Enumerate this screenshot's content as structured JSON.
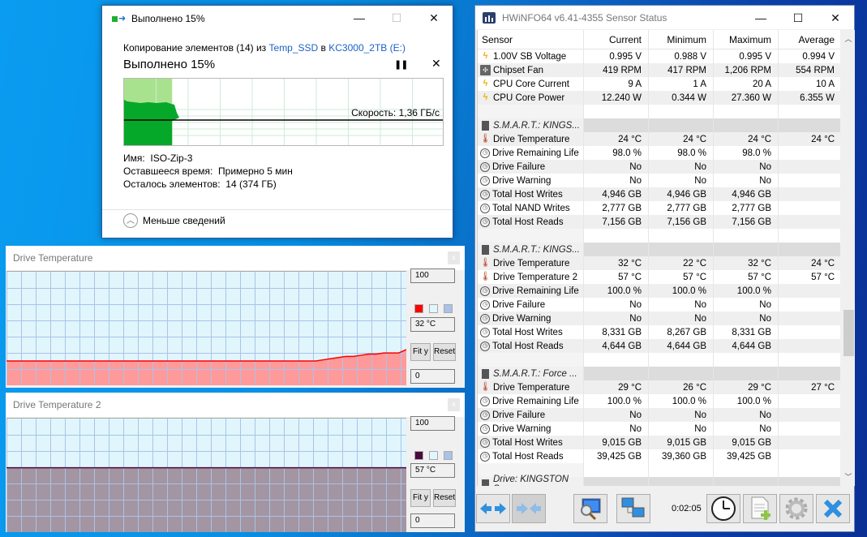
{
  "copy_dialog": {
    "title": "Выполнено 15%",
    "line_prefix": "Копирование элементов (14) из ",
    "source": "Temp_SSD",
    "line_mid": " в ",
    "dest": "KC3000_2TB (E:)",
    "progress_label": "Выполнено 15%",
    "progress_percent": 15,
    "pause_icon": "pause-icon",
    "cancel_icon": "close-icon",
    "speed": "Скорость: 1,36 ГБ/с",
    "name_label": "Имя:",
    "name_value": "ISO-Zip-3",
    "time_label": "Оставшееся время:",
    "time_value": "Примерно 5 мин",
    "items_label": "Осталось элементов:",
    "items_value": "14 (374 ГБ)",
    "less_details": "Меньше сведений",
    "caption": {
      "minimize": "—",
      "maximize": "☐",
      "close": "✕"
    }
  },
  "graph_windows": [
    {
      "title": "Drive Temperature",
      "max": "100",
      "current": "32 °C",
      "min": "0",
      "fit_label": "Fit y",
      "reset_label": "Reset",
      "close": "x",
      "line_color": "#ff0000",
      "fill_color": "#ff9a9a",
      "bg_color": "#e0f6fc",
      "grid_color": "#a9c3e8",
      "chart_data": {
        "type": "area",
        "ylim": [
          0,
          100
        ],
        "values_note": "flat ~22 then step up to ~32 at end",
        "values": [
          22,
          22,
          22,
          22,
          22,
          22,
          22,
          22,
          22,
          22,
          22,
          22,
          22,
          22,
          22,
          22,
          22,
          22,
          22,
          22,
          22,
          22,
          22,
          22,
          22,
          22,
          22,
          22,
          22,
          22,
          22,
          22,
          22,
          22,
          22,
          22,
          22,
          22,
          22,
          22,
          22,
          22,
          23,
          24,
          25,
          26,
          26,
          27,
          28,
          28,
          29,
          29,
          29,
          32
        ]
      }
    },
    {
      "title": "Drive Temperature 2",
      "max": "100",
      "current": "57 °C",
      "min": "0",
      "fit_label": "Fit y",
      "reset_label": "Reset",
      "close": "x",
      "line_color": "#4a0a3a",
      "fill_color": "#a395a2",
      "bg_color": "#e0f6fc",
      "grid_color": "#a9c3e8",
      "chart_data": {
        "type": "area",
        "ylim": [
          0,
          100
        ],
        "values": [
          57,
          57,
          57,
          57,
          57,
          57,
          57,
          57,
          57,
          57
        ]
      }
    }
  ],
  "hwinfo": {
    "title": "HWiNFO64 v6.41-4355 Sensor Status",
    "caption": {
      "minimize": "—",
      "maximize": "☐",
      "close": "✕"
    },
    "columns": [
      "Sensor",
      "Current",
      "Minimum",
      "Maximum",
      "Average"
    ],
    "rows": [
      {
        "type": "data",
        "icon": "bolt",
        "cells": [
          "1.00V SB Voltage",
          "0.995 V",
          "0.988 V",
          "0.995 V",
          "0.994 V"
        ]
      },
      {
        "type": "data",
        "icon": "fan",
        "cells": [
          "Chipset Fan",
          "419 RPM",
          "417 RPM",
          "1,206 RPM",
          "554 RPM"
        ]
      },
      {
        "type": "data",
        "icon": "bolt",
        "cells": [
          "CPU Core Current",
          "9 A",
          "1 A",
          "20 A",
          "10 A"
        ]
      },
      {
        "type": "data",
        "icon": "bolt",
        "cells": [
          "CPU Core Power",
          "12.240 W",
          "0.344 W",
          "27.360 W",
          "6.355 W"
        ]
      },
      {
        "type": "blank",
        "cells": [
          "",
          "",
          "",
          "",
          ""
        ]
      },
      {
        "type": "group",
        "icon": "chip",
        "cells": [
          "S.M.A.R.T.: KINGS...",
          "",
          "",
          "",
          ""
        ]
      },
      {
        "type": "data",
        "icon": "therm",
        "cells": [
          "Drive Temperature",
          "24 °C",
          "24 °C",
          "24 °C",
          "24 °C"
        ]
      },
      {
        "type": "data",
        "icon": "clock",
        "cells": [
          "Drive Remaining Life",
          "98.0 %",
          "98.0 %",
          "98.0 %",
          ""
        ]
      },
      {
        "type": "data",
        "icon": "clock",
        "cells": [
          "Drive Failure",
          "No",
          "No",
          "No",
          ""
        ]
      },
      {
        "type": "data",
        "icon": "clock",
        "cells": [
          "Drive Warning",
          "No",
          "No",
          "No",
          ""
        ]
      },
      {
        "type": "data",
        "icon": "clock",
        "cells": [
          "Total Host Writes",
          "4,946 GB",
          "4,946 GB",
          "4,946 GB",
          ""
        ]
      },
      {
        "type": "data",
        "icon": "clock",
        "cells": [
          "Total NAND Writes",
          "2,777 GB",
          "2,777 GB",
          "2,777 GB",
          ""
        ]
      },
      {
        "type": "data",
        "icon": "clock",
        "cells": [
          "Total Host Reads",
          "7,156 GB",
          "7,156 GB",
          "7,156 GB",
          ""
        ]
      },
      {
        "type": "blank",
        "cells": [
          "",
          "",
          "",
          "",
          ""
        ]
      },
      {
        "type": "group",
        "icon": "chip",
        "cells": [
          "S.M.A.R.T.: KINGS...",
          "",
          "",
          "",
          ""
        ]
      },
      {
        "type": "data",
        "icon": "therm",
        "cells": [
          "Drive Temperature",
          "32 °C",
          "22 °C",
          "32 °C",
          "24 °C"
        ]
      },
      {
        "type": "data",
        "icon": "therm",
        "cells": [
          "Drive Temperature 2",
          "57 °C",
          "57 °C",
          "57 °C",
          "57 °C"
        ]
      },
      {
        "type": "data",
        "icon": "clock",
        "cells": [
          "Drive Remaining Life",
          "100.0 %",
          "100.0 %",
          "100.0 %",
          ""
        ]
      },
      {
        "type": "data",
        "icon": "clock",
        "cells": [
          "Drive Failure",
          "No",
          "No",
          "No",
          ""
        ]
      },
      {
        "type": "data",
        "icon": "clock",
        "cells": [
          "Drive Warning",
          "No",
          "No",
          "No",
          ""
        ]
      },
      {
        "type": "data",
        "icon": "clock",
        "cells": [
          "Total Host Writes",
          "8,331 GB",
          "8,267 GB",
          "8,331 GB",
          ""
        ]
      },
      {
        "type": "data",
        "icon": "clock",
        "cells": [
          "Total Host Reads",
          "4,644 GB",
          "4,644 GB",
          "4,644 GB",
          ""
        ]
      },
      {
        "type": "blank",
        "cells": [
          "",
          "",
          "",
          "",
          ""
        ]
      },
      {
        "type": "group",
        "icon": "chip",
        "cells": [
          "S.M.A.R.T.: Force ...",
          "",
          "",
          "",
          ""
        ]
      },
      {
        "type": "data",
        "icon": "therm",
        "cells": [
          "Drive Temperature",
          "29 °C",
          "26 °C",
          "29 °C",
          "27 °C"
        ]
      },
      {
        "type": "data",
        "icon": "clock",
        "cells": [
          "Drive Remaining Life",
          "100.0 %",
          "100.0 %",
          "100.0 %",
          ""
        ]
      },
      {
        "type": "data",
        "icon": "clock",
        "cells": [
          "Drive Failure",
          "No",
          "No",
          "No",
          ""
        ]
      },
      {
        "type": "data",
        "icon": "clock",
        "cells": [
          "Drive Warning",
          "No",
          "No",
          "No",
          ""
        ]
      },
      {
        "type": "data",
        "icon": "clock",
        "cells": [
          "Total Host Writes",
          "9,015 GB",
          "9,015 GB",
          "9,015 GB",
          ""
        ]
      },
      {
        "type": "data",
        "icon": "clock",
        "cells": [
          "Total Host Reads",
          "39,425 GB",
          "39,360 GB",
          "39,425 GB",
          ""
        ]
      },
      {
        "type": "blank",
        "cells": [
          "",
          "",
          "",
          "",
          ""
        ]
      },
      {
        "type": "group",
        "icon": "chip",
        "cells": [
          "Drive: KINGSTON S...",
          "",
          "",
          "",
          ""
        ]
      }
    ],
    "timer": "0:02:05",
    "toolbar": [
      {
        "name": "expand-columns-button",
        "icon": "arrows-out-icon"
      },
      {
        "name": "collapse-columns-button",
        "icon": "arrows-in-icon",
        "disabled": true
      },
      {
        "name": "network-monitor-button",
        "icon": "monitor-search-icon"
      },
      {
        "name": "remote-button",
        "icon": "network-computers-icon"
      },
      {
        "name": "reset-timer-button",
        "icon": "clock-icon"
      },
      {
        "name": "logging-button",
        "icon": "add-log-icon"
      },
      {
        "name": "settings-button",
        "icon": "gear-icon"
      },
      {
        "name": "close-button",
        "icon": "close-x-icon"
      }
    ]
  }
}
